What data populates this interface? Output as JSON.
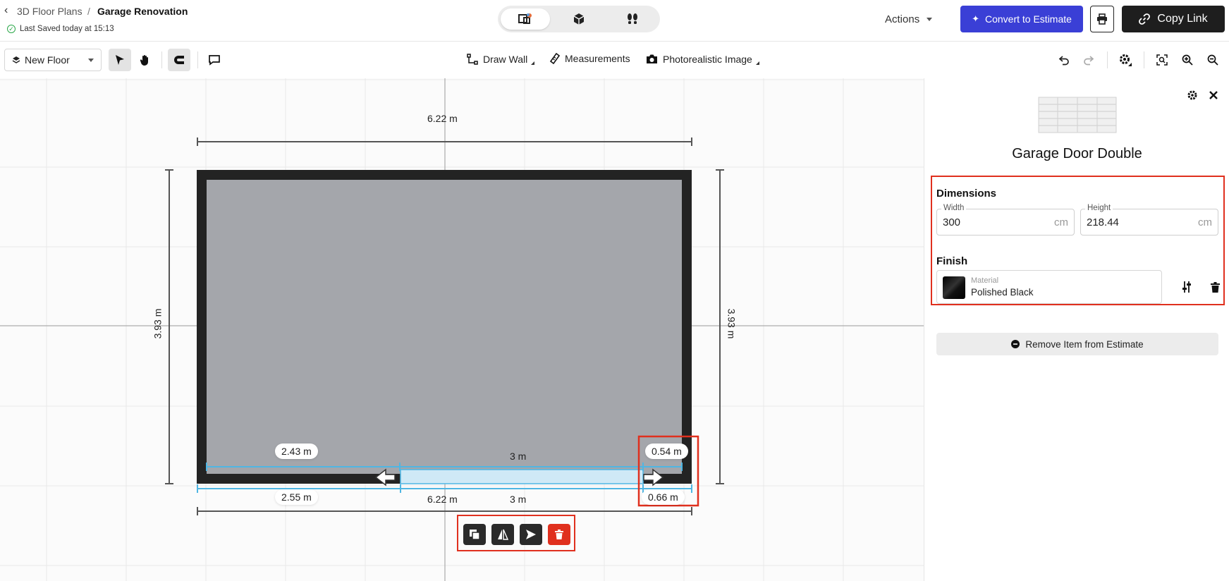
{
  "header": {
    "breadcrumb_parent": "3D Floor Plans",
    "breadcrumb_separator": "/",
    "breadcrumb_current": "Garage Renovation",
    "saved_status": "Last Saved today at 15:13",
    "actions_label": "Actions",
    "convert_label": "Convert to Estimate",
    "copy_link_label": "Copy Link"
  },
  "toolbar": {
    "floor_label": "New Floor",
    "draw_wall_label": "Draw Wall",
    "measurements_label": "Measurements",
    "photo_label": "Photorealistic Image"
  },
  "canvas": {
    "top_width": "6.22 m",
    "left_height": "3.93 m",
    "right_height": "3.93 m",
    "door_left_inner": "2.43 m",
    "door_width_inner": "3 m",
    "door_right_inner": "0.54 m",
    "door_left_outer": "2.55 m",
    "bottom_width": "6.22 m",
    "door_width_outer": "3 m",
    "door_right_outer": "0.66 m"
  },
  "panel": {
    "title": "Garage Door Double",
    "dimensions_label": "Dimensions",
    "width_label": "Width",
    "width_value": "300",
    "width_unit": "cm",
    "height_label": "Height",
    "height_value": "218.44",
    "height_unit": "cm",
    "finish_label": "Finish",
    "material_label": "Material",
    "material_value": "Polished Black",
    "remove_label": "Remove Item from Estimate"
  },
  "colors": {
    "accent": "#3a3fd6",
    "highlight": "#e0301e",
    "measure": "#4fb6e3",
    "success": "#2ca84a"
  }
}
